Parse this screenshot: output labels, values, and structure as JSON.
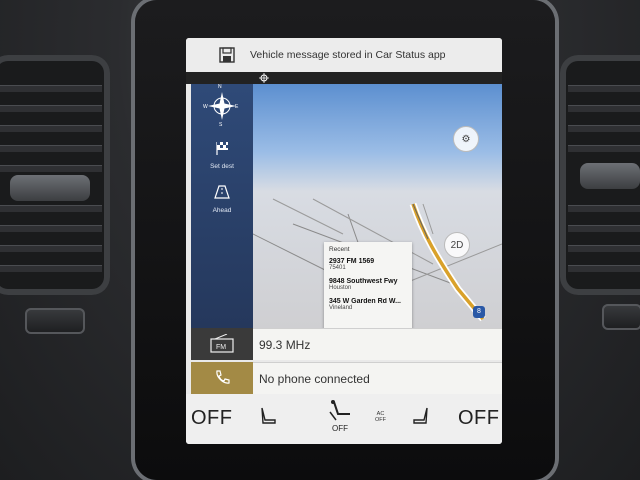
{
  "notification": {
    "text": "Vehicle message stored in Car Status app",
    "icon": "save-icon"
  },
  "sidebar": {
    "compass": {
      "n": "N",
      "s": "S",
      "e": "E",
      "w": "W"
    },
    "items": [
      {
        "label": "Set dest",
        "icon": "checkered-flag-icon"
      },
      {
        "label": "Ahead",
        "icon": "road-ahead-icon"
      }
    ]
  },
  "map": {
    "view_mode_label": "2D",
    "route_color": "#d9a12a",
    "highway_shield": "8"
  },
  "recent": {
    "header": "Recent",
    "entries": [
      {
        "line1": "2937 FM 1569",
        "line2": "75401"
      },
      {
        "line1": "9848 Southwest Fwy",
        "line2": "Houston"
      },
      {
        "line1": "345 W Garden Rd W...",
        "line2": "Vineland"
      }
    ]
  },
  "radio": {
    "icon_label": "FM",
    "frequency": "99.3 MHz"
  },
  "phone": {
    "status": "No phone connected"
  },
  "climate": {
    "left_temp": "OFF",
    "right_temp": "OFF",
    "fan_label": "OFF",
    "ac_label_top": "AC",
    "ac_label_bottom": "OFF"
  },
  "colors": {
    "sidebar": "#2f4a78",
    "phone_accent": "#a38a45",
    "radio_accent": "#3a3a3a"
  }
}
